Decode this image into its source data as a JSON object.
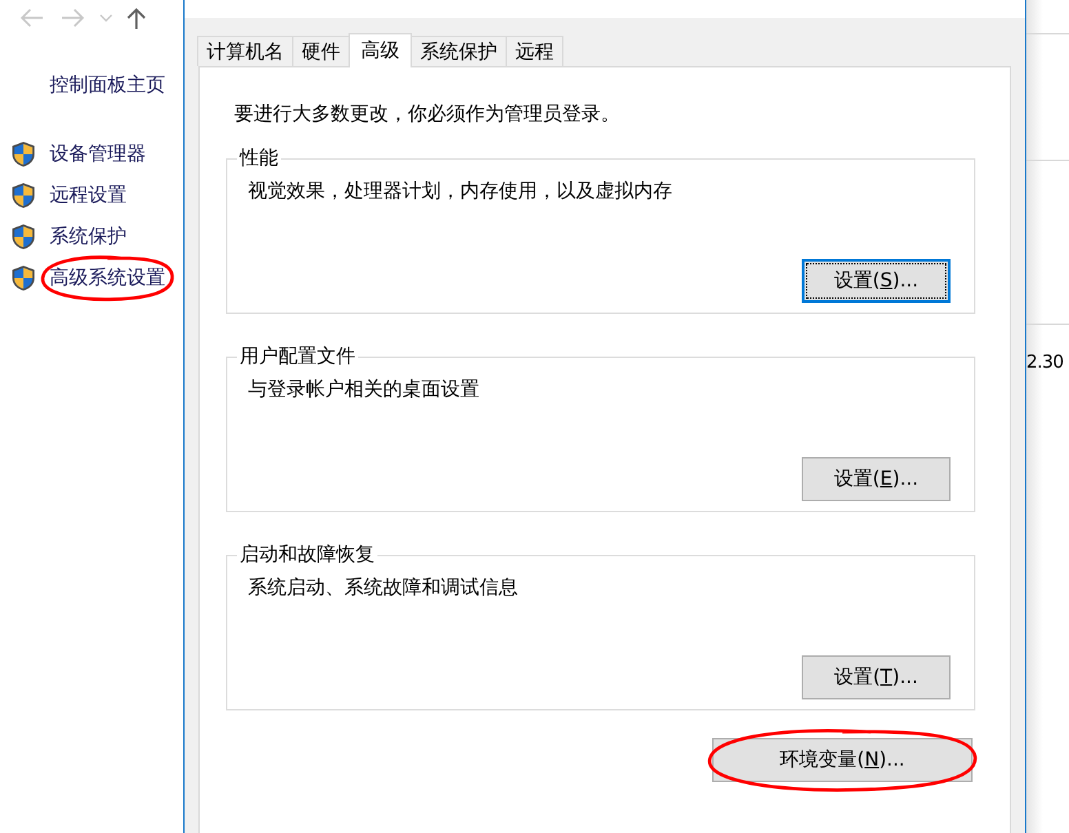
{
  "sidebar": {
    "home_link": "控制面板主页",
    "items": [
      {
        "label": "设备管理器",
        "circled": false
      },
      {
        "label": "远程设置",
        "circled": false
      },
      {
        "label": "系统保护",
        "circled": false
      },
      {
        "label": "高级系统设置",
        "circled": true
      }
    ]
  },
  "dialog": {
    "tabs": [
      {
        "label": "计算机名",
        "selected": false
      },
      {
        "label": "硬件",
        "selected": false
      },
      {
        "label": "高级",
        "selected": true
      },
      {
        "label": "系统保护",
        "selected": false
      },
      {
        "label": "远程",
        "selected": false
      }
    ],
    "admin_note": "要进行大多数更改，你必须作为管理员登录。",
    "groups": [
      {
        "title": "性能",
        "description": "视觉效果，处理器计划，内存使用，以及虚拟内存",
        "button": {
          "before": "设置(",
          "key": "S",
          "after": ")...",
          "focused": true
        }
      },
      {
        "title": "用户配置文件",
        "description": "与登录帐户相关的桌面设置",
        "button": {
          "before": "设置(",
          "key": "E",
          "after": ")...",
          "focused": false
        }
      },
      {
        "title": "启动和故障恢复",
        "description": "系统启动、系统故障和调试信息",
        "button": {
          "before": "设置(",
          "key": "T",
          "after": ")...",
          "focused": false
        }
      }
    ],
    "env_button": {
      "before": "环境变量(",
      "key": "N",
      "after": ")...",
      "focused": false,
      "circled": true
    }
  },
  "background_window": {
    "text": "2.30"
  }
}
